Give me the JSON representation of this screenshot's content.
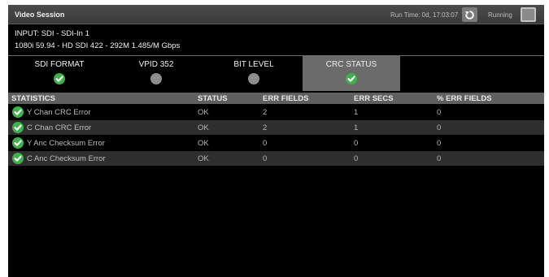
{
  "header": {
    "title": "Video Session",
    "run_time": "Run Time: 0d, 17:03:07",
    "running_label": "Running"
  },
  "signal": {
    "input": "INPUT: SDI - SDI-In 1",
    "format": "1080i 59.94 - HD SDI 422 -  292M 1.485/M Gbps"
  },
  "tabs": [
    {
      "label": "SDI FORMAT",
      "icon": "check-icon",
      "active": false
    },
    {
      "label": "VPID 352",
      "icon": "gray-dot-icon",
      "active": false
    },
    {
      "label": "BIT LEVEL",
      "icon": "gray-dot-icon",
      "active": false
    },
    {
      "label": "CRC STATUS",
      "icon": "check-icon",
      "active": true
    }
  ],
  "table": {
    "headers": [
      "STATISTICS",
      "STATUS",
      "ERR FIELDS",
      "ERR SECS",
      "% ERR FIELDS"
    ],
    "rows": [
      {
        "name": "Y Chan CRC Error",
        "status": "OK",
        "err_fields": "2",
        "err_secs": "1",
        "pct_err_fields": "0"
      },
      {
        "name": "C Chan CRC Error",
        "status": "OK",
        "err_fields": "2",
        "err_secs": "1",
        "pct_err_fields": "0"
      },
      {
        "name": "Y Anc Checksum Error",
        "status": "OK",
        "err_fields": "0",
        "err_secs": "0",
        "pct_err_fields": "0"
      },
      {
        "name": "C Anc Checksum Error",
        "status": "OK",
        "err_fields": "0",
        "err_secs": "0",
        "pct_err_fields": "0"
      }
    ]
  },
  "colors": {
    "ok_green": "#3fb14a",
    "active_tab": "#6b6b6b",
    "table_header": "#5f5f5f"
  }
}
